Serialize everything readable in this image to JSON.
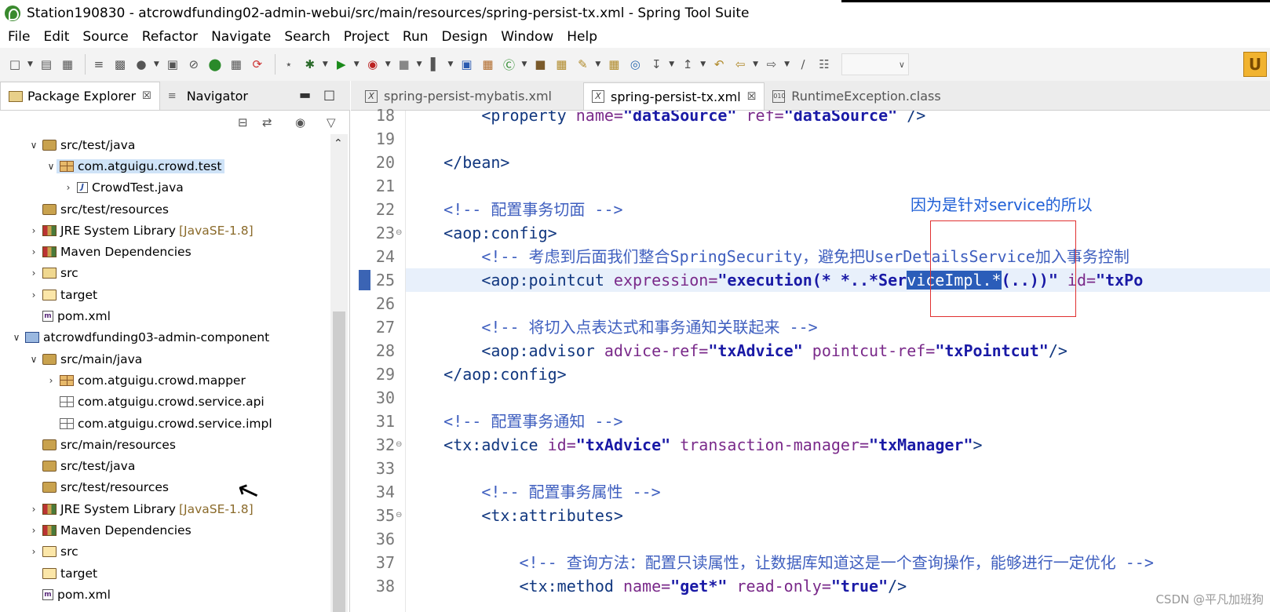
{
  "window": {
    "title": "Station190830 - atcrowdfunding02-admin-webui/src/main/resources/spring-persist-tx.xml - Spring Tool Suite"
  },
  "menu": [
    "File",
    "Edit",
    "Source",
    "Refactor",
    "Navigate",
    "Search",
    "Project",
    "Run",
    "Design",
    "Window",
    "Help"
  ],
  "left_pane": {
    "tabs": [
      {
        "label": "Package Explorer",
        "close": "☒"
      },
      {
        "label": "Navigator"
      }
    ],
    "tree": [
      {
        "label": "src/test/java",
        "icon": "source-folder-icon",
        "level": 1,
        "expand": "v"
      },
      {
        "label": "com.atguigu.crowd.test",
        "icon": "package-icon",
        "level": 2,
        "expand": "v",
        "selected": true
      },
      {
        "label": "CrowdTest.java",
        "icon": "java-file-icon",
        "level": 3,
        "expand": ">"
      },
      {
        "label": "src/test/resources",
        "icon": "source-folder-icon",
        "level": 1,
        "expand": ""
      },
      {
        "label": "JRE System Library",
        "decor": "[JavaSE-1.8]",
        "icon": "library-icon",
        "level": 1,
        "expand": ">"
      },
      {
        "label": "Maven Dependencies",
        "icon": "library-icon",
        "level": 1,
        "expand": ">"
      },
      {
        "label": "src",
        "icon": "src-folder-icon",
        "level": 1,
        "expand": ">"
      },
      {
        "label": "target",
        "icon": "folder-icon",
        "level": 1,
        "expand": ">"
      },
      {
        "label": "pom.xml",
        "icon": "pom-file-icon",
        "level": 1,
        "expand": ""
      },
      {
        "label": "atcrowdfunding03-admin-component",
        "icon": "project-icon",
        "level": 0,
        "expand": "v"
      },
      {
        "label": "src/main/java",
        "icon": "source-folder-icon",
        "level": 1,
        "expand": "v"
      },
      {
        "label": "com.atguigu.crowd.mapper",
        "icon": "package-icon",
        "level": 2,
        "expand": ">"
      },
      {
        "label": "com.atguigu.crowd.service.api",
        "icon": "empty-package-icon",
        "level": 2,
        "expand": ""
      },
      {
        "label": "com.atguigu.crowd.service.impl",
        "icon": "empty-package-icon",
        "level": 2,
        "expand": ""
      },
      {
        "label": "src/main/resources",
        "icon": "source-folder-icon",
        "level": 1,
        "expand": ""
      },
      {
        "label": "src/test/java",
        "icon": "source-folder-icon",
        "level": 1,
        "expand": ""
      },
      {
        "label": "src/test/resources",
        "icon": "source-folder-icon",
        "level": 1,
        "expand": ""
      },
      {
        "label": "JRE System Library",
        "decor": "[JavaSE-1.8]",
        "icon": "library-icon",
        "level": 1,
        "expand": ">"
      },
      {
        "label": "Maven Dependencies",
        "icon": "library-icon",
        "level": 1,
        "expand": ">"
      },
      {
        "label": "src",
        "icon": "folder-icon",
        "level": 1,
        "expand": ">"
      },
      {
        "label": "target",
        "icon": "folder-icon",
        "level": 1,
        "expand": ""
      },
      {
        "label": "pom.xml",
        "icon": "pom-file-icon",
        "level": 1,
        "expand": ""
      }
    ]
  },
  "editor": {
    "tabs": [
      {
        "label": "spring-persist-mybatis.xml",
        "active": false,
        "icon": "xml-file-icon"
      },
      {
        "label": "spring-persist-tx.xml",
        "active": true,
        "close": "☒",
        "icon": "xml-file-icon"
      },
      {
        "label": "RuntimeException.class",
        "active": false,
        "icon": "class-file-icon"
      }
    ],
    "current_line": 25,
    "lines": [
      {
        "n": "18",
        "fold": "",
        "html_parts": [
          [
            "tag",
            "        <property "
          ],
          [
            "attr",
            "name="
          ],
          [
            "str",
            "\"dataSource\""
          ],
          [
            "attr",
            " ref="
          ],
          [
            "str",
            "\"dataSource\""
          ],
          [
            "tag",
            " />"
          ]
        ]
      },
      {
        "n": "19",
        "fold": "",
        "html_parts": []
      },
      {
        "n": "20",
        "fold": "",
        "html_parts": [
          [
            "tag",
            "    </bean>"
          ]
        ]
      },
      {
        "n": "21",
        "fold": "",
        "html_parts": []
      },
      {
        "n": "22",
        "fold": "",
        "html_parts": [
          [
            "cmt",
            "    <!-- 配置事务切面 -->"
          ]
        ]
      },
      {
        "n": "23",
        "fold": "⊖",
        "html_parts": [
          [
            "tag",
            "    <aop:config>"
          ]
        ]
      },
      {
        "n": "24",
        "fold": "",
        "html_parts": [
          [
            "cmt",
            "        <!-- 考虑到后面我们整合SpringSecurity，避免把UserDetailsService加入事务控制"
          ]
        ]
      },
      {
        "n": "25",
        "fold": "",
        "html_parts": [
          [
            "tag",
            "        <aop:pointcut "
          ],
          [
            "attr",
            "expression="
          ],
          [
            "str",
            "\"execution(* *..*Ser"
          ],
          [
            "sel",
            "viceImpl.*"
          ],
          [
            "str",
            "(..))\""
          ],
          [
            "attr",
            " id="
          ],
          [
            "str",
            "\"txPo"
          ]
        ]
      },
      {
        "n": "26",
        "fold": "",
        "html_parts": []
      },
      {
        "n": "27",
        "fold": "",
        "html_parts": [
          [
            "cmt",
            "        <!-- 将切入点表达式和事务通知关联起来 -->"
          ]
        ]
      },
      {
        "n": "28",
        "fold": "",
        "html_parts": [
          [
            "tag",
            "        <aop:advisor "
          ],
          [
            "attr",
            "advice-ref="
          ],
          [
            "str",
            "\"txAdvice\""
          ],
          [
            "attr",
            " pointcut-ref="
          ],
          [
            "str",
            "\"txPointcut\""
          ],
          [
            "tag",
            "/>"
          ]
        ]
      },
      {
        "n": "29",
        "fold": "",
        "html_parts": [
          [
            "tag",
            "    </aop:config>"
          ]
        ]
      },
      {
        "n": "30",
        "fold": "",
        "html_parts": []
      },
      {
        "n": "31",
        "fold": "",
        "html_parts": [
          [
            "cmt",
            "    <!-- 配置事务通知 -->"
          ]
        ]
      },
      {
        "n": "32",
        "fold": "⊖",
        "html_parts": [
          [
            "tag",
            "    <tx:advice "
          ],
          [
            "attr",
            "id="
          ],
          [
            "str",
            "\"txAdvice\""
          ],
          [
            "attr",
            " transaction-manager="
          ],
          [
            "str",
            "\"txManager\""
          ],
          [
            "tag",
            ">"
          ]
        ]
      },
      {
        "n": "33",
        "fold": "",
        "html_parts": []
      },
      {
        "n": "34",
        "fold": "",
        "html_parts": [
          [
            "cmt",
            "        <!-- 配置事务属性 -->"
          ]
        ]
      },
      {
        "n": "35",
        "fold": "⊖",
        "html_parts": [
          [
            "tag",
            "        <tx:attributes>"
          ]
        ]
      },
      {
        "n": "36",
        "fold": "",
        "html_parts": []
      },
      {
        "n": "37",
        "fold": "",
        "html_parts": [
          [
            "cmt",
            "            <!-- 查询方法：配置只读属性，让数据库知道这是一个查询操作，能够进行一定优化 -->"
          ]
        ]
      },
      {
        "n": "38",
        "fold": "",
        "html_parts": [
          [
            "tag",
            "            <tx:method "
          ],
          [
            "attr",
            "name="
          ],
          [
            "str",
            "\"get*\""
          ],
          [
            "attr",
            " read-only="
          ],
          [
            "str",
            "\"true\""
          ],
          [
            "tag",
            "/>"
          ]
        ]
      }
    ]
  },
  "annotation": "因为是针对service的所以",
  "watermark": "CSDN @平凡加班狗",
  "colors": {
    "selection": "#2b5db9",
    "annotation": "#1f5fd6",
    "redbox": "#e03030"
  }
}
